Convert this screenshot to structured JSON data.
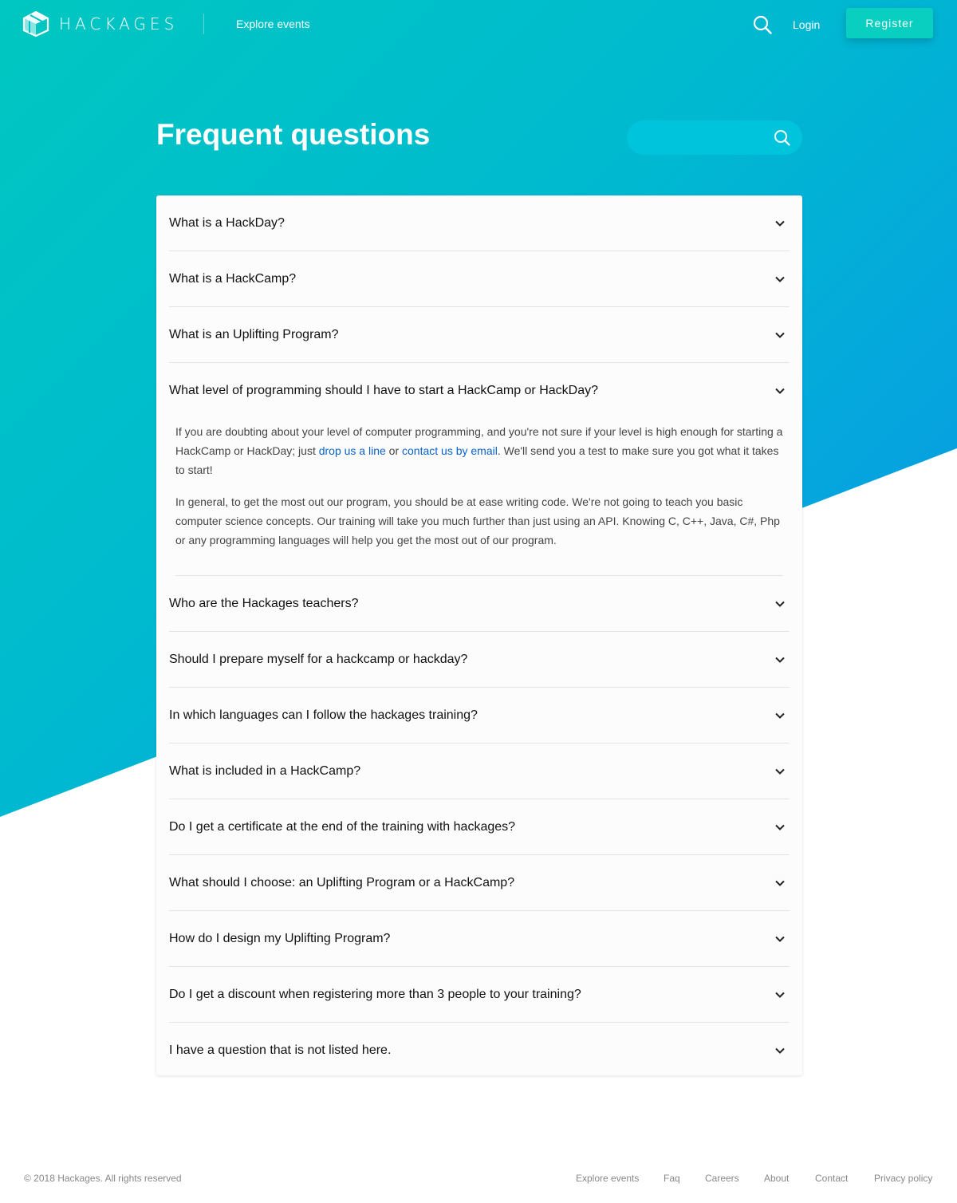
{
  "brand": {
    "name": "HACKAGES"
  },
  "nav": {
    "explore": "Explore events",
    "login": "Login",
    "register": "Register"
  },
  "page": {
    "title": "Frequent questions"
  },
  "search": {
    "placeholder": ""
  },
  "faq": {
    "items": [
      {
        "question": "What is a HackDay?"
      },
      {
        "question": "What is a HackCamp?"
      },
      {
        "question": "What is an Uplifting Program?"
      },
      {
        "question": "What level of programming should I have to start a HackCamp or HackDay?"
      },
      {
        "question": "Who are the Hackages teachers?"
      },
      {
        "question": "Should I prepare myself for a hackcamp or hackday?"
      },
      {
        "question": "In which languages can I follow the hackages training?"
      },
      {
        "question": "What is included in a HackCamp?"
      },
      {
        "question": "Do I get a certificate at the end of the training with hackages?"
      },
      {
        "question": "What should I choose: an Uplifting Program or a HackCamp?"
      },
      {
        "question": "How do I design my Uplifting Program?"
      },
      {
        "question": "Do I get a discount when registering more than 3 people to your training?"
      },
      {
        "question": "I have a question that is not listed here."
      }
    ],
    "open_answer": {
      "p1_a": "If you are doubting about your level of computer programming, and you're not sure if your level is high enough for starting a HackCamp or HackDay; just ",
      "p1_link1": "drop us a line",
      "p1_b": " or ",
      "p1_link2": "contact us by email",
      "p1_c": ". We'll send you a test to make sure you got what it takes to start!",
      "p2": "In general, to get the most out our program, you should be at ease writing code. We're not going to teach you basic computer science concepts. Our training will take you much further than just using an API. Knowing C, C++, Java, C#, Php or any programming languages will help you get the most out of our program."
    }
  },
  "footer": {
    "copyright": "© 2018 Hackages. All rights reserved",
    "links": [
      "Explore events",
      "Faq",
      "Careers",
      "About",
      "Contact",
      "Privacy policy"
    ]
  },
  "colors": {
    "gradient_start": "#00c7c1",
    "gradient_end": "#0a93ea",
    "register_button": "#08cfc0",
    "link": "#0b63c9"
  },
  "icons": [
    "hackages-logo-icon",
    "search-icon",
    "chevron-down-icon"
  ]
}
